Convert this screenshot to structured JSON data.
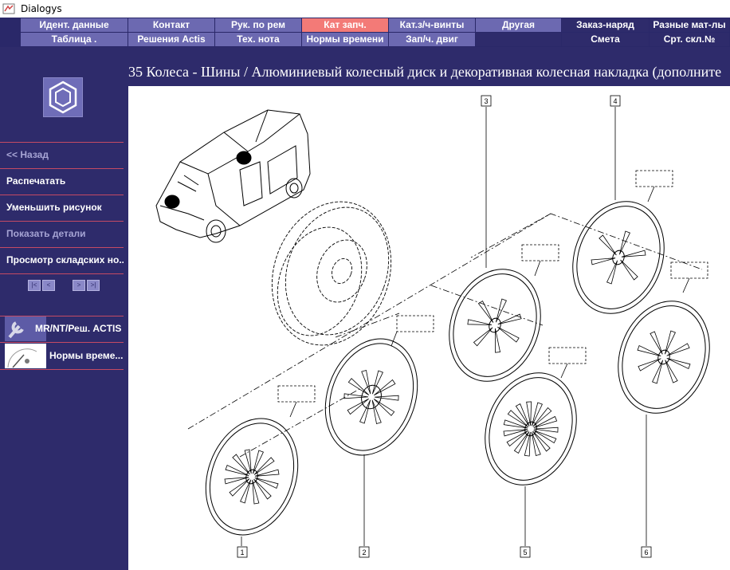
{
  "window": {
    "title": "Dialogys"
  },
  "tabs": {
    "row1": [
      "Идент. данные",
      "Контакт",
      "Рук. по рем",
      "Кат запч.",
      "Кат.з/ч-винты",
      "Другая",
      "Заказ-наряд",
      "Разные мат-лы"
    ],
    "row2": [
      "Таблица .",
      "Решения Actis",
      "Тех. нота",
      "Нормы времени",
      "Зап/ч. двиг",
      "",
      "Смета",
      "Срт. скл.№"
    ],
    "active": "Кат запч."
  },
  "sidebar": {
    "items": [
      {
        "label": "<< Назад",
        "enabled": false
      },
      {
        "label": "Распечатать",
        "enabled": true
      },
      {
        "label": "Уменьшить рисунок",
        "enabled": true
      },
      {
        "label": "Показать детали",
        "enabled": false
      },
      {
        "label": "Просмотр складских но...",
        "enabled": true
      }
    ],
    "buttons": [
      {
        "label": "MR/NT/Реш. ACTIS"
      },
      {
        "label": "Нормы време..."
      }
    ]
  },
  "content": {
    "heading": "35 Колеса - Шины / Алюминиевый колесный диск и декоративная колесная накладка (дополните",
    "callouts": [
      "1",
      "2",
      "3",
      "4",
      "5",
      "6"
    ]
  },
  "colors": {
    "background": "#2e2b6b",
    "tab_light": "#6c69b1",
    "tab_active": "#f37a77",
    "separator": "#c54a63"
  }
}
